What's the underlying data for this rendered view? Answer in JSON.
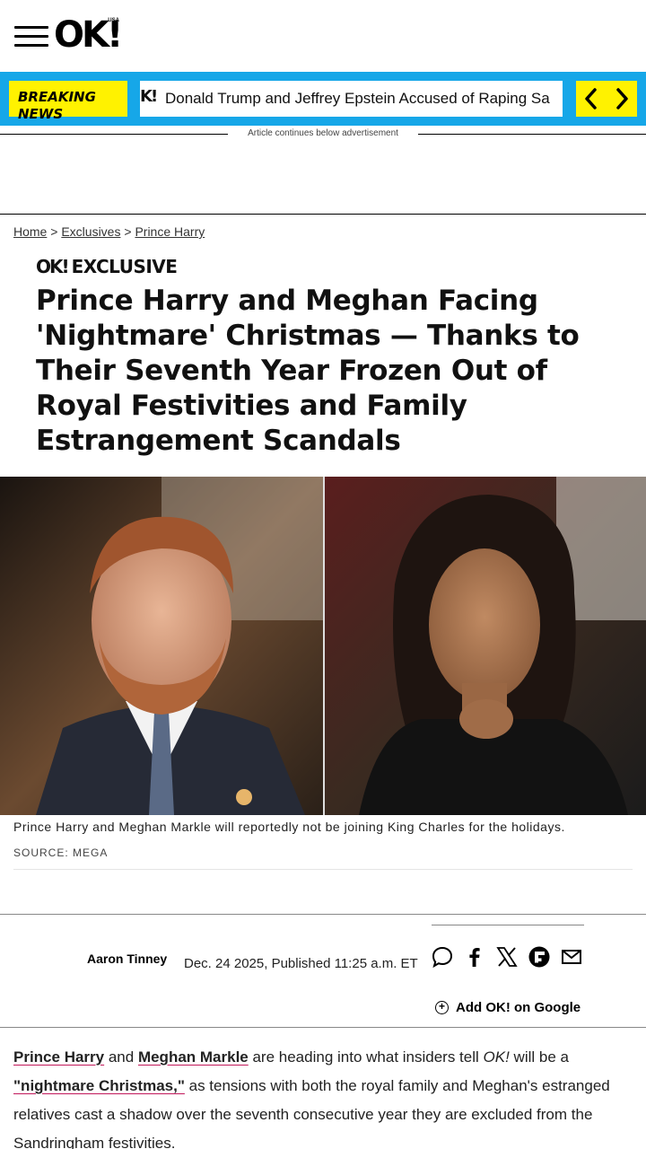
{
  "header": {
    "logo_text": "OK!",
    "logo_sup": "USA"
  },
  "breaking": {
    "label_line1": "BREAKING",
    "label_line2": "NEWS",
    "ticker_icon": "K!",
    "ticker_text": "Donald Trump and Jeffrey Epstein Accused of Raping Sa",
    "colors": {
      "bar": "#16a7e8",
      "label": "#fff200"
    }
  },
  "ad_notice": "Article continues below advertisement",
  "breadcrumb": {
    "home": "Home",
    "sep1": ">",
    "section": "Exclusives",
    "sep2": ">",
    "topic": "Prince Harry"
  },
  "tag": {
    "logo": "OK!",
    "label": "EXCLUSIVE"
  },
  "headline": "Prince Harry and Meghan Facing 'Nightmare' Christmas — Thanks to Their Seventh Year Frozen Out of Royal Festivities and Family Estrangement Scandals",
  "image": {
    "caption": "Prince Harry and Meghan Markle will reportedly not be joining King Charles for the holidays.",
    "source": "SOURCE: MEGA"
  },
  "byline": {
    "author": "Aaron Tinney",
    "date": "Dec. 24 2025, Published 11:25 a.m. ET",
    "share_icons": [
      "comment-icon",
      "facebook-icon",
      "x-icon",
      "flipboard-icon",
      "email-icon"
    ],
    "add_google": "Add OK! on Google"
  },
  "body": {
    "link1": "Prince Harry",
    "text1": " and ",
    "link2": "Meghan Markle",
    "text2": " are heading into what insiders tell ",
    "italic": "OK!",
    "text3": " will be a ",
    "link3": "\"nightmare Christmas,\"",
    "text4": " as tensions with both the royal family and Meghan's estranged relatives cast a shadow over the seventh consecutive year they are excluded from the Sandringham festivities."
  }
}
